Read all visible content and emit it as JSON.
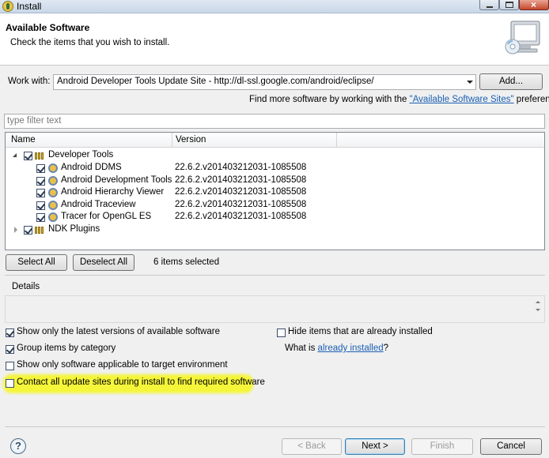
{
  "window": {
    "title": "Install",
    "title_extra": "",
    "minimize_icon": "minimize-icon",
    "maximize_icon": "maximize-icon",
    "close_glyph": "×"
  },
  "header": {
    "title": "Available Software",
    "subtitle": "Check the items that you wish to install."
  },
  "work_with": {
    "label": "Work with:",
    "value": "Android Developer Tools Update Site - http://dl-ssl.google.com/android/eclipse/",
    "add_button": "Add...",
    "find_more_prefix": "Find more software by working with the",
    "find_more_link": "\"Available Software Sites\"",
    "find_more_suffix": "preferences."
  },
  "filter": {
    "placeholder": "type filter text"
  },
  "tree": {
    "columns": [
      "Name",
      "Version"
    ],
    "groups": [
      {
        "name": "Developer Tools",
        "expanded": true,
        "checked": true,
        "items": [
          {
            "name": "Android DDMS",
            "version": "22.6.2.v201403212031-1085508",
            "checked": true
          },
          {
            "name": "Android Development Tools",
            "version": "22.6.2.v201403212031-1085508",
            "checked": true
          },
          {
            "name": "Android Hierarchy Viewer",
            "version": "22.6.2.v201403212031-1085508",
            "checked": true
          },
          {
            "name": "Android Traceview",
            "version": "22.6.2.v201403212031-1085508",
            "checked": true
          },
          {
            "name": "Tracer for OpenGL ES",
            "version": "22.6.2.v201403212031-1085508",
            "checked": true
          }
        ]
      },
      {
        "name": "NDK Plugins",
        "expanded": false,
        "checked": true,
        "items": []
      }
    ]
  },
  "selection": {
    "select_all": "Select All",
    "deselect_all": "Deselect All",
    "status": "6 items selected"
  },
  "details": {
    "label": "Details"
  },
  "options": {
    "latest_only": {
      "label": "Show only the latest versions of available software",
      "checked": true
    },
    "group_by_category": {
      "label": "Group items by category",
      "checked": true
    },
    "target_env": {
      "label": "Show only software applicable to target environment",
      "checked": false
    },
    "contact_sites": {
      "label": "Contact all update sites during install to find required software",
      "checked": false
    },
    "hide_installed": {
      "label": "Hide items that are already installed",
      "checked": false
    },
    "what_is_prefix": "What is",
    "already_installed_link": "already installed",
    "what_is_suffix": "?"
  },
  "footer": {
    "help_glyph": "?",
    "back": "< Back",
    "next": "Next >",
    "finish": "Finish",
    "cancel": "Cancel"
  },
  "colors": {
    "highlight": "#f5f53a",
    "link": "#1a5fb4"
  }
}
